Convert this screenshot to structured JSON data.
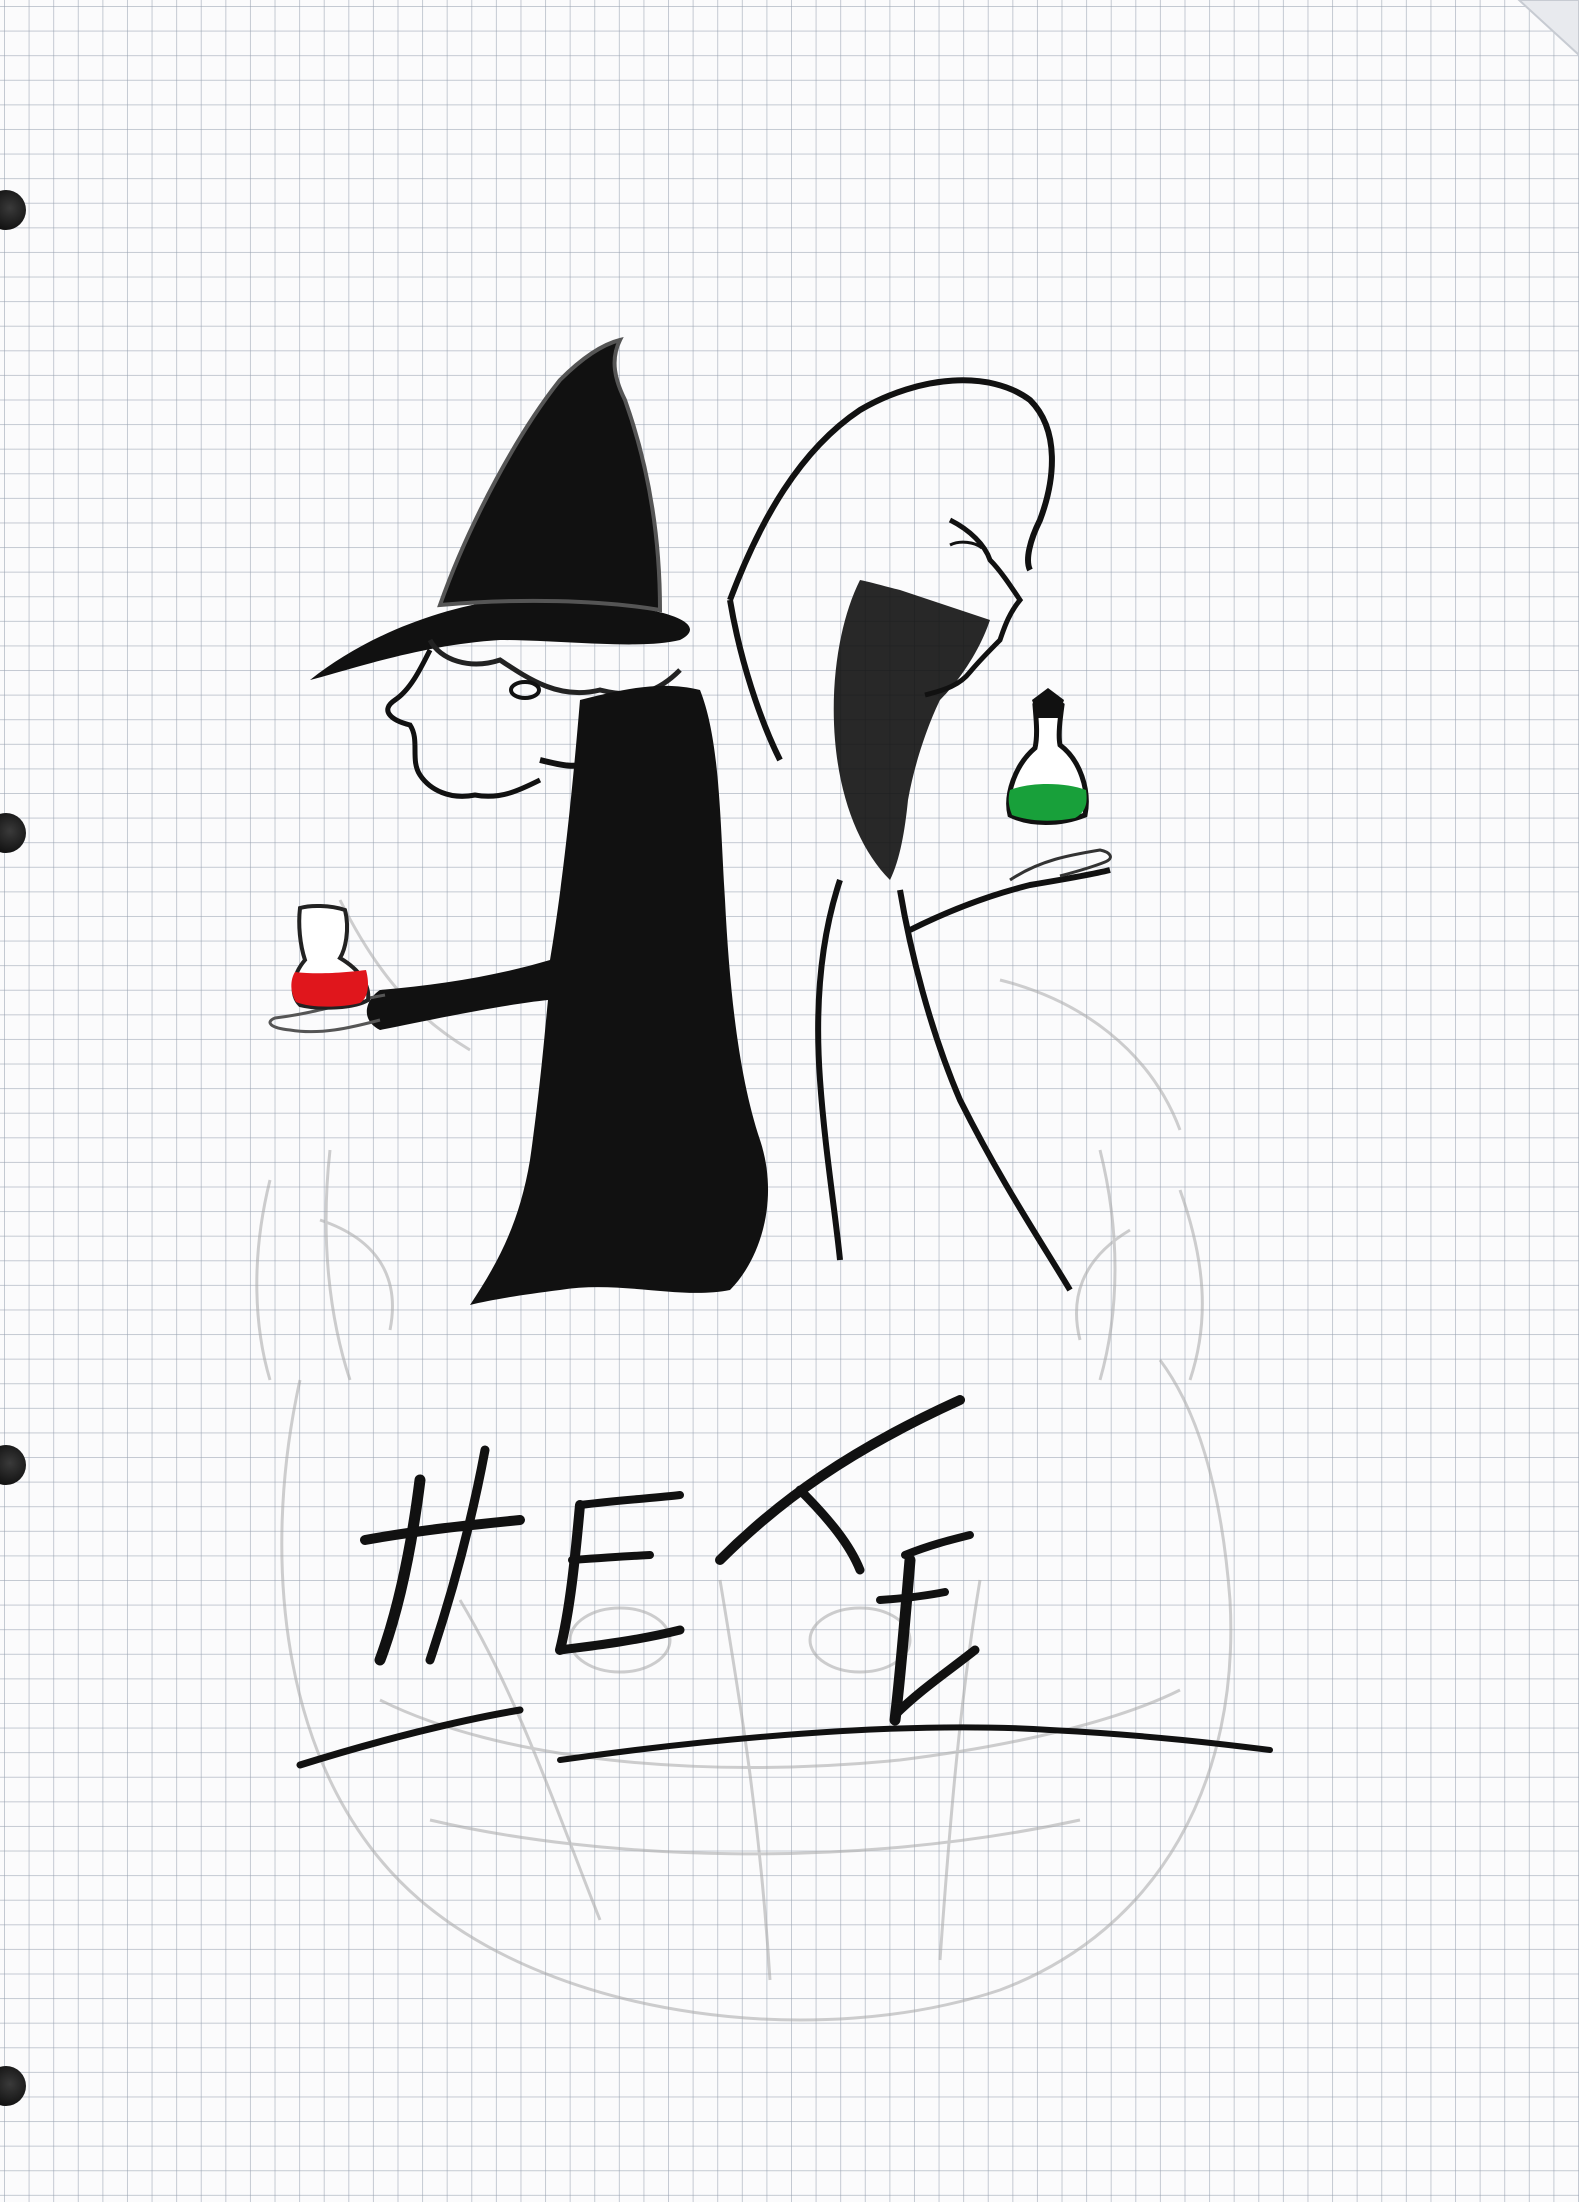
{
  "drawing": {
    "title": "HEXE"
  },
  "colors": {
    "paper": "#fbfbfc",
    "grid": "#96a0af",
    "ink": "#111111",
    "pencil": "#9a9a9a",
    "red_potion": "#e0161c",
    "green_potion": "#18a03a"
  },
  "icons": {
    "hole": "punch-hole-icon",
    "red_flask": "red-potion-flask-icon",
    "green_flask": "green-potion-flask-icon"
  }
}
